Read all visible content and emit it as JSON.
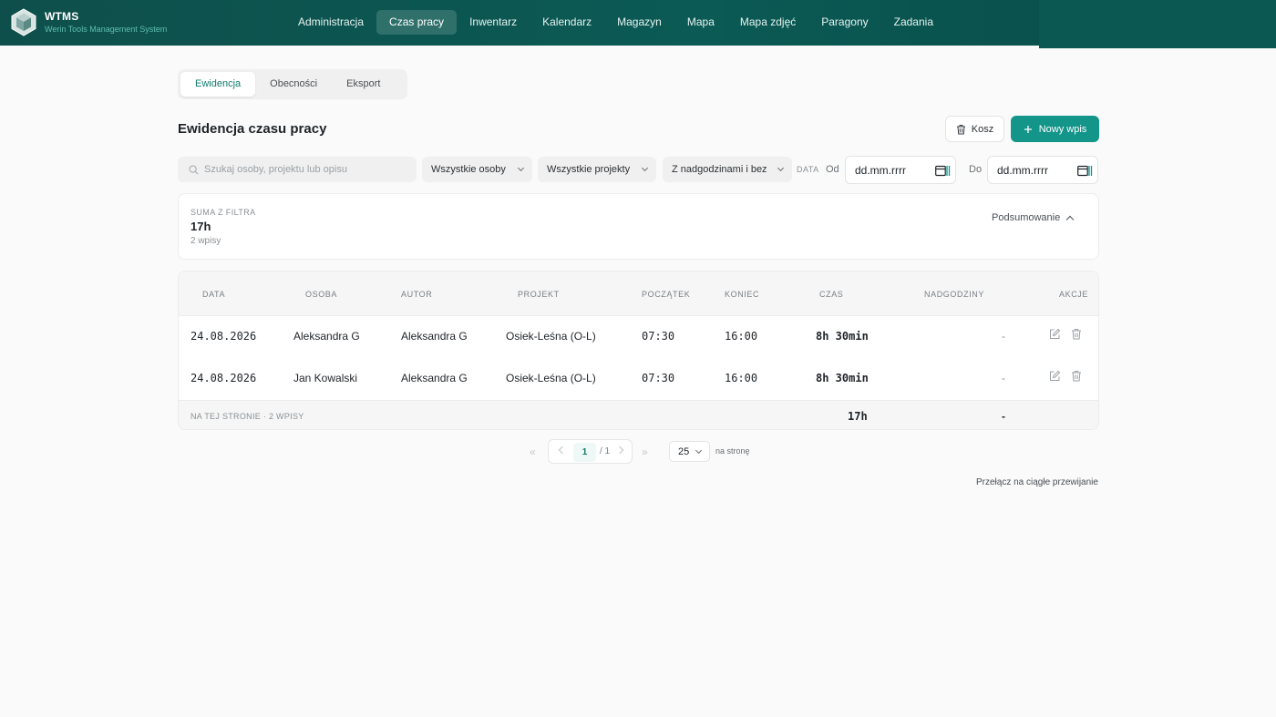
{
  "brand": {
    "title": "WTMS",
    "subtitle": "Werin Tools Management System"
  },
  "nav": [
    {
      "label": "Administracja",
      "active": false
    },
    {
      "label": "Czas pracy",
      "active": true
    },
    {
      "label": "Inwentarz",
      "active": false
    },
    {
      "label": "Kalendarz",
      "active": false
    },
    {
      "label": "Magazyn",
      "active": false
    },
    {
      "label": "Mapa",
      "active": false
    },
    {
      "label": "Mapa zdjęć",
      "active": false
    },
    {
      "label": "Paragony",
      "active": false
    },
    {
      "label": "Zadania",
      "active": false
    }
  ],
  "subtabs": [
    {
      "label": "Ewidencja",
      "active": true
    },
    {
      "label": "Obecności",
      "active": false
    },
    {
      "label": "Eksport",
      "active": false
    }
  ],
  "page": {
    "title": "Ewidencja czasu pracy"
  },
  "actions": {
    "trash_label": "Kosz",
    "new_label": "Nowy wpis"
  },
  "filters": {
    "search_placeholder": "Szukaj osoby, projektu lub opisu",
    "person": "Wszystkie osoby",
    "project": "Wszystkie projekty",
    "overtime": "Z nadgodzinami i bez",
    "date_label": "DATA",
    "from_label": "Od",
    "to_label": "Do",
    "from_value": "dd.mm.rrrr",
    "to_value": "dd.mm.rrrr"
  },
  "summary": {
    "label": "SUMA Z FILTRA",
    "value": "17h",
    "count": "2 wpisy",
    "toggle": "Podsumowanie"
  },
  "table": {
    "headers": {
      "date": "DATA",
      "person": "OSOBA",
      "author": "AUTOR",
      "project": "PROJEKT",
      "start": "POCZĄTEK",
      "end": "KONIEC",
      "time": "CZAS",
      "overtime": "NADGODZINY",
      "actions": "AKCJE"
    },
    "rows": [
      {
        "date": "24.08.2026",
        "person": "Aleksandra G",
        "author": "Aleksandra G",
        "project": "Osiek-Leśna (O-L)",
        "start": "07:30",
        "end": "16:00",
        "time": "8h 30min",
        "overtime": "-"
      },
      {
        "date": "24.08.2026",
        "person": "Jan Kowalski",
        "author": "Aleksandra G",
        "project": "Osiek-Leśna (O-L)",
        "start": "07:30",
        "end": "16:00",
        "time": "8h 30min",
        "overtime": "-"
      }
    ],
    "footer": {
      "label": "NA TEJ STRONIE · 2 WPISY",
      "time_total": "17h",
      "overtime_total": "-"
    }
  },
  "pagination": {
    "first": "«",
    "last": "»",
    "current": "1",
    "total": "/ 1",
    "per_page": "25",
    "per_page_label": "na stronę"
  },
  "switch_link": "Przełącz na ciągłe przewijanie",
  "colors": {
    "accent": "#13958a",
    "nav_bg": "#0b5a55",
    "active_tab_text": "#0f7a6e"
  }
}
